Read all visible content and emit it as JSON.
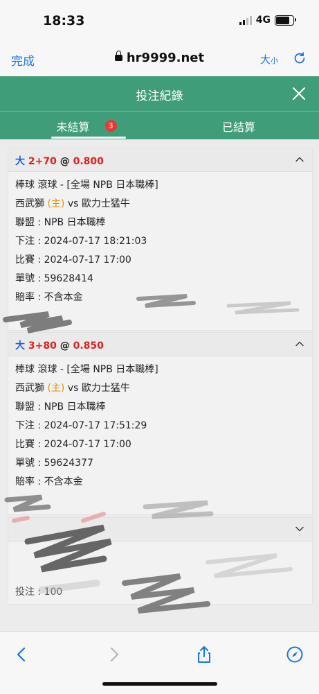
{
  "status_bar": {
    "time": "18:33",
    "network": "4G"
  },
  "browser": {
    "done_label": "完成",
    "url": "hr9999.net",
    "text_size_label_big": "大",
    "text_size_label_small": "小"
  },
  "modal": {
    "title": "投注紀錄",
    "tabs": [
      {
        "label": "未結算",
        "badge": "3",
        "active": true
      },
      {
        "label": "已結算",
        "active": false
      }
    ]
  },
  "bets": [
    {
      "side": "大",
      "handicap": "2+70",
      "at": "@",
      "odds": "0.800",
      "sport_line": "棒球 滾球 - [全場 NPB 日本職棒]",
      "home_team": "西武獅",
      "home_tag": "(主)",
      "vs": "vs",
      "away_team": "歐力士猛牛",
      "league": "聯盟 : NPB 日本職棒",
      "bet_time": "下注 : 2024-07-17 18:21:03",
      "match_time": "比賽 : 2024-07-17 17:00",
      "ticket_no": "單號 : 59628414",
      "odds_note": "賠率 : 不含本金"
    },
    {
      "side": "大",
      "handicap": "3+80",
      "at": "@",
      "odds": "0.850",
      "sport_line": "棒球 滾球 - [全場 NPB 日本職棒]",
      "home_team": "西武獅",
      "home_tag": "(主)",
      "vs": "vs",
      "away_team": "歐力士猛牛",
      "league": "聯盟 : NPB 日本職棒",
      "bet_time": "下注 : 2024-07-17 17:51:29",
      "match_time": "比賽 : 2024-07-17 17:00",
      "ticket_no": "單號 : 59624377",
      "odds_note": "賠率 : 不含本金"
    }
  ],
  "third_card": {
    "stake_label": "投注 : 100"
  },
  "colors": {
    "header_green": "#3f9e79",
    "accent_blue": "#1f5fd6",
    "odds_red": "#e02020",
    "home_orange": "#f08c00",
    "badge_red": "#e53935"
  },
  "icons": [
    "lock-icon",
    "reload-icon",
    "close-icon",
    "chevron-up-icon",
    "chevron-down-icon",
    "back-icon",
    "forward-icon",
    "share-icon",
    "compass-icon"
  ]
}
